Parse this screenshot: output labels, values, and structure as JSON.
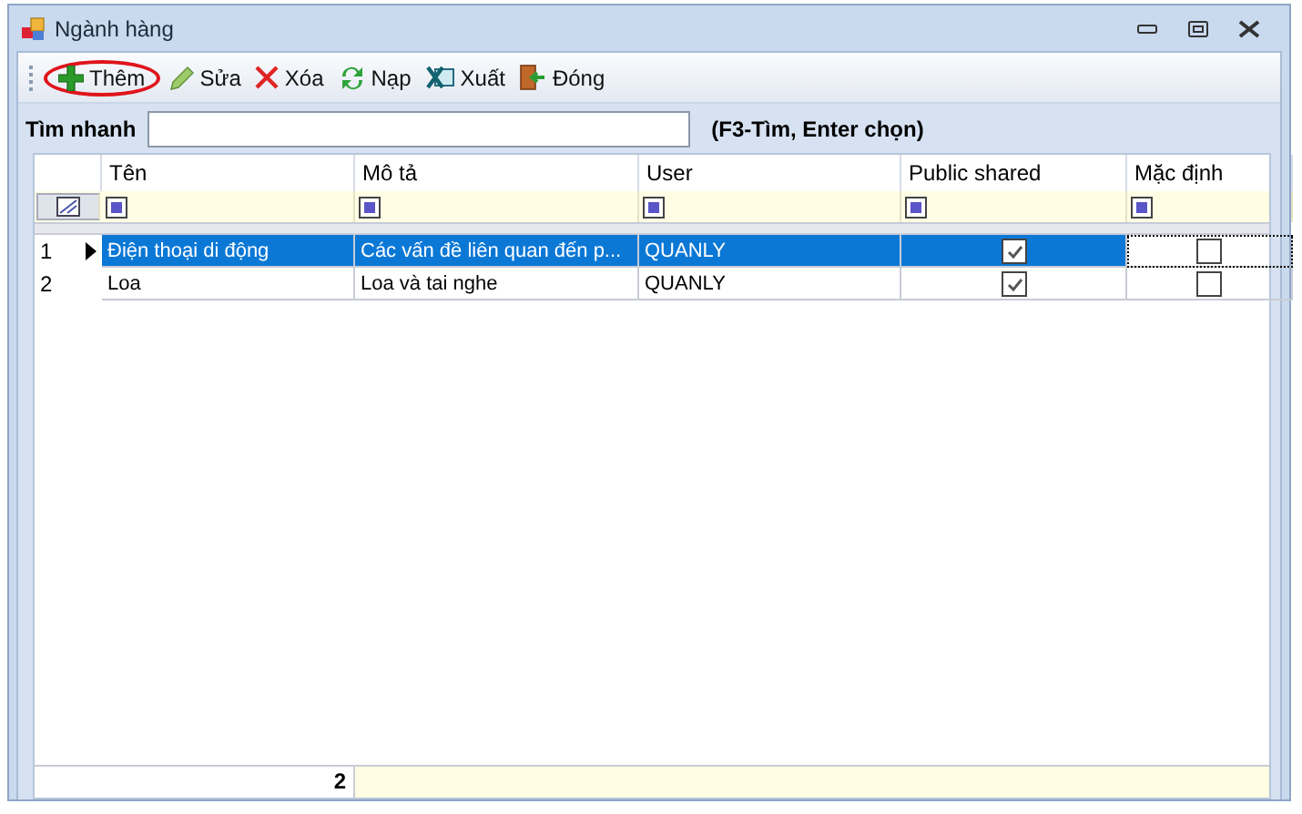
{
  "window": {
    "title": "Ngành hàng"
  },
  "toolbar": [
    {
      "label": "Thêm",
      "kind": "add",
      "circled": true
    },
    {
      "label": "Sửa",
      "kind": "edit",
      "circled": false
    },
    {
      "label": "Xóa",
      "kind": "delete",
      "circled": false
    },
    {
      "label": "Nạp",
      "kind": "reload",
      "circled": false
    },
    {
      "label": "Xuất",
      "kind": "export",
      "circled": false
    },
    {
      "label": "Đóng",
      "kind": "close",
      "circled": false
    }
  ],
  "search": {
    "label": "Tìm nhanh",
    "hint": "(F3-Tìm, Enter chọn)"
  },
  "table": {
    "columns": [
      "Tên",
      "Mô tả",
      "User",
      "Public shared",
      "Mặc định"
    ],
    "filters": [
      {
        "checked": true
      },
      {
        "checked": true
      },
      {
        "checked": true
      },
      {
        "checked": true
      },
      {
        "checked": true
      }
    ],
    "rows": [
      {
        "number": "1",
        "selected": true,
        "current": true,
        "name": "Điện thoại di động",
        "description": "Các vấn đề liên quan đến p...",
        "user": "QUANLY",
        "public_shared": true,
        "default": false
      },
      {
        "number": "2",
        "selected": false,
        "current": false,
        "name": "Loa",
        "description": "Loa và tai nghe",
        "user": "QUANLY",
        "public_shared": true,
        "default": false
      }
    ],
    "footer_count": "2"
  }
}
